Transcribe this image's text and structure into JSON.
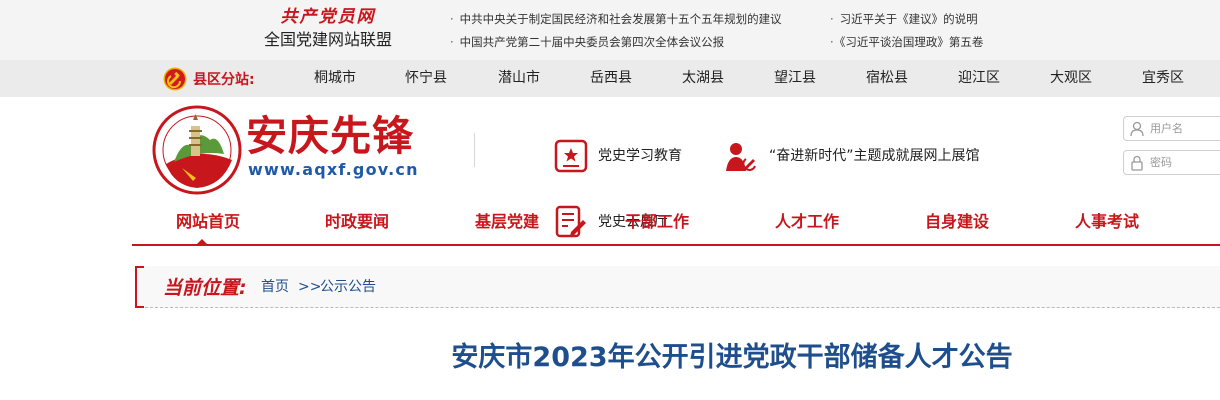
{
  "topbar": {
    "union_script": "共产党员网",
    "union_name": "全国党建网站联盟",
    "links": [
      "中共中央关于制定国民经济和社会发展第十五个五年规划的建议",
      "习近平关于《建议》的说明",
      "中国共产党第二十届中央委员会第四次全体会议公报",
      "《习近平谈治国理政》第五卷"
    ]
  },
  "region": {
    "label": "县区分站:",
    "items": [
      "桐城市",
      "怀宁县",
      "潜山市",
      "岳西县",
      "太湖县",
      "望江县",
      "宿松县",
      "迎江区",
      "大观区",
      "宜秀区"
    ]
  },
  "header": {
    "logo_title": "安庆先锋",
    "logo_url": "www.aqxf.gov.cn",
    "links": [
      "党史学习教育",
      "“奋进新时代”主题成就展网上展馆",
      "党史云展厅"
    ],
    "username_placeholder": "用户名",
    "password_placeholder": "密码"
  },
  "nav": {
    "items": [
      "网站首页",
      "时政要闻",
      "基层党建",
      "干部工作",
      "人才工作",
      "自身建设",
      "人事考试"
    ]
  },
  "breadcrumb": {
    "label": "当前位置:",
    "home": "首页",
    "separator": ">>",
    "current": "公示公告"
  },
  "article": {
    "title": "安庆市2023年公开引进党政干部储备人才公告"
  },
  "colors": {
    "brand_red": "#c8161d",
    "link_blue": "#1f4e8c"
  }
}
